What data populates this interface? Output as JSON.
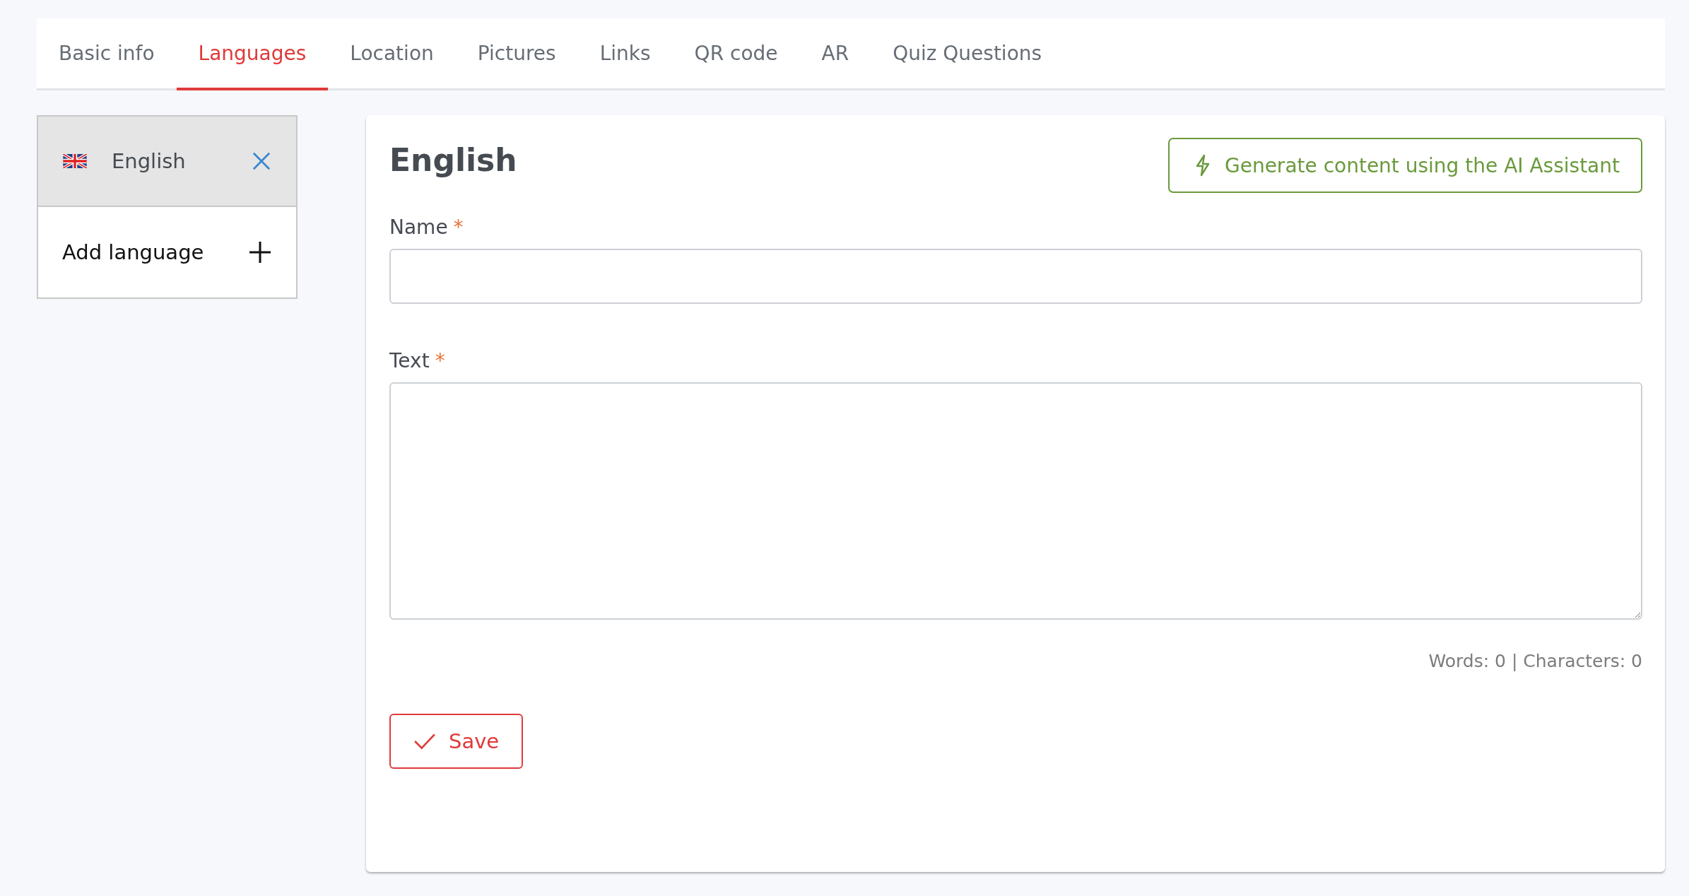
{
  "tabs": [
    {
      "label": "Basic info",
      "selected": false
    },
    {
      "label": "Languages",
      "selected": true
    },
    {
      "label": "Location",
      "selected": false
    },
    {
      "label": "Pictures",
      "selected": false
    },
    {
      "label": "Links",
      "selected": false
    },
    {
      "label": "QR code",
      "selected": false
    },
    {
      "label": "AR",
      "selected": false
    },
    {
      "label": "Quiz Questions",
      "selected": false
    }
  ],
  "languages": [
    {
      "name": "English",
      "selected": true
    }
  ],
  "add_language": {
    "label": "Add language"
  },
  "editor": {
    "heading": "English",
    "ai_button": "Generate content using the AI Assistant",
    "fields": [
      {
        "kind": "input",
        "label": "Name",
        "required_mark": "*"
      },
      {
        "kind": "textarea",
        "label": "Text",
        "required_mark": "*"
      }
    ],
    "counter": "Words: 0 | Characters: 0",
    "save_button": "Save"
  }
}
